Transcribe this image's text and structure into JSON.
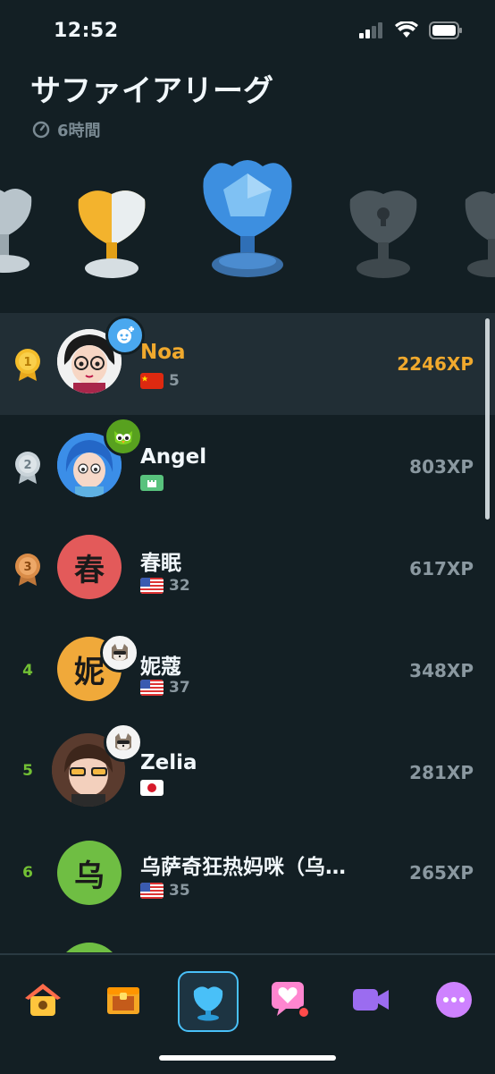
{
  "status_bar": {
    "time": "12:52"
  },
  "header": {
    "title": "サファイアリーグ",
    "timer": "6時間"
  },
  "leaderboard": [
    {
      "rank": "1",
      "name": "Noa",
      "flag": "china",
      "count": "5",
      "xp": "2246XP",
      "highlight": true
    },
    {
      "rank": "2",
      "name": "Angel",
      "flag": "castle",
      "count": "",
      "xp": "803XP"
    },
    {
      "rank": "3",
      "name": "春眠",
      "flag": "usa",
      "count": "32",
      "xp": "617XP",
      "initial": "春"
    },
    {
      "rank": "4",
      "name": "妮蔻",
      "flag": "usa",
      "count": "37",
      "xp": "348XP",
      "initial": "妮"
    },
    {
      "rank": "5",
      "name": "Zelia",
      "flag": "japan",
      "count": "",
      "xp": "281XP"
    },
    {
      "rank": "6",
      "name": "乌萨奇狂热妈咪（乌…",
      "flag": "usa",
      "count": "35",
      "xp": "265XP",
      "initial": "乌"
    }
  ],
  "colors": {
    "highlight_xp": "#f0a92d",
    "rank_green": "#72c034",
    "active_tab": "#49c0f8"
  },
  "tabs": [
    "home-icon",
    "treasure-chest-icon",
    "leaderboard-trophy-icon",
    "heart-chat-icon",
    "video-icon",
    "more-icon"
  ]
}
